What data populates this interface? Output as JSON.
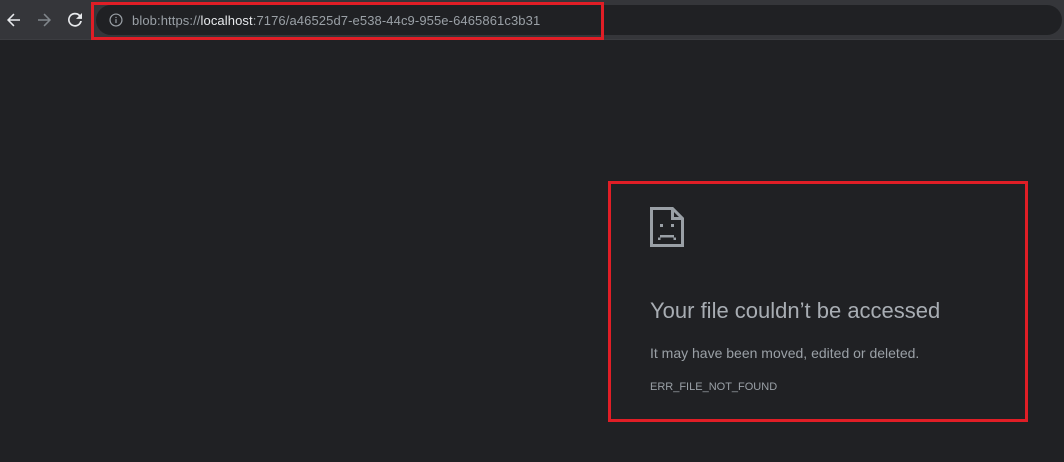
{
  "browser": {
    "back_icon": "arrow-left-icon",
    "forward_icon": "arrow-right-icon",
    "reload_icon": "reload-icon",
    "info_icon": "info-icon",
    "url_prefix": "blob:https://",
    "url_host": "localhost",
    "url_suffix": ":7176/a46525d7-e538-44c9-955e-6465861c3b31"
  },
  "error": {
    "icon": "sad-file-icon",
    "title": "Your file couldn’t be accessed",
    "description": "It may have been moved, edited or deleted.",
    "code": "ERR_FILE_NOT_FOUND"
  },
  "colors": {
    "page_background": "#202124",
    "toolbar_background": "#35363a",
    "highlight": "#e01e26"
  }
}
